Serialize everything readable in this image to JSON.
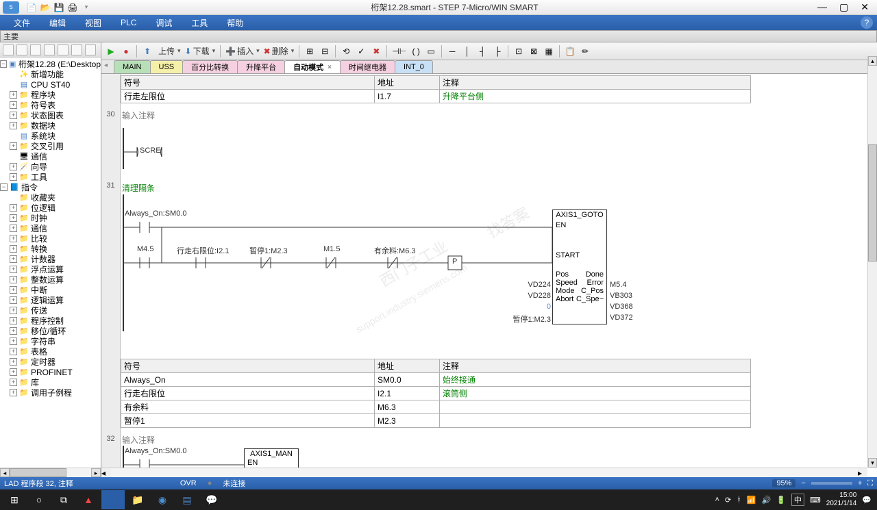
{
  "title": "桁架12.28.smart - STEP 7-Micro/WIN SMART",
  "menu": {
    "file": "文件",
    "edit": "编辑",
    "view": "视图",
    "plc": "PLC",
    "debug": "调试",
    "tools": "工具",
    "help": "帮助"
  },
  "panel_title": "主要",
  "toolbar": {
    "upload": "上传",
    "download": "下载",
    "insert": "插入",
    "delete": "删除"
  },
  "tree": {
    "project": "桁架12.28 (E:\\Desktop",
    "new_feature": "新增功能",
    "cpu": "CPU ST40",
    "program_block": "程序块",
    "symbol_table": "符号表",
    "status_chart": "状态图表",
    "data_block": "数据块",
    "system_block": "系统块",
    "cross_ref": "交叉引用",
    "communication": "通信",
    "wizard": "向导",
    "tool": "工具",
    "instructions": "指令",
    "favorites": "收藏夹",
    "bit_logic": "位逻辑",
    "clock": "时钟",
    "comm2": "通信",
    "compare": "比较",
    "convert": "转换",
    "counter": "计数器",
    "float": "浮点运算",
    "integer": "整数运算",
    "interrupt": "中断",
    "logic_ops": "逻辑运算",
    "transfer": "传送",
    "program_ctrl": "程序控制",
    "shift": "移位/循环",
    "string": "字符串",
    "table": "表格",
    "timer": "定时器",
    "profinet": "PROFINET",
    "library": "库",
    "subroutine": "调用子例程"
  },
  "tabs": {
    "main": "MAIN",
    "uss": "USS",
    "percent": "百分比转换",
    "lift": "升降平台",
    "auto": "自动模式",
    "timer": "时间继电器",
    "int0": "INT_0"
  },
  "sym_hdr": {
    "symbol": "符号",
    "address": "地址",
    "comment": "注释"
  },
  "net29": {
    "sym": "行走左限位",
    "addr": "I1.7",
    "comment": "升降平台侧"
  },
  "net30": {
    "num": "30",
    "placeholder": "输入注释",
    "inst": "SCRE"
  },
  "net31": {
    "num": "31",
    "comment": "清理隔条",
    "always_on": "Always_On:SM0.0",
    "contacts": {
      "m45": "M4.5",
      "limit": "行走右限位:I2.1",
      "pause": "暂停1:M2.3",
      "m15": "M1.5",
      "surplus": "有余料:M6.3",
      "p": "P"
    },
    "fb": {
      "title": "AXIS1_GOTO",
      "en": "EN",
      "start": "START",
      "pos_l": "VD224",
      "pos": "Pos",
      "done": "Done",
      "done_r": "M5.4",
      "speed_l": "VD228",
      "speed": "Speed",
      "error": "Error",
      "error_r": "VB303",
      "mode_l": "0",
      "mode": "Mode",
      "cpos": "C_Pos",
      "cpos_r": "VD368",
      "abort_l": "暂停1:M2.3",
      "abort": "Abort",
      "cspe": "C_Spe~",
      "cspe_r": "VD372"
    },
    "table": [
      {
        "sym": "Always_On",
        "addr": "SM0.0",
        "comment": "始终接通"
      },
      {
        "sym": "行走右限位",
        "addr": "I2.1",
        "comment": "滚筒侧"
      },
      {
        "sym": "有余料",
        "addr": "M6.3",
        "comment": ""
      },
      {
        "sym": "暂停1",
        "addr": "M2.3",
        "comment": ""
      }
    ]
  },
  "net32": {
    "num": "32",
    "placeholder": "输入注释",
    "always_on": "Always_On:SM0.0",
    "fb": {
      "title": "AXIS1_MAN",
      "en": "EN"
    }
  },
  "status": {
    "pos": "LAD 程序段 32, 注释",
    "ovr": "OVR",
    "conn": "未连接",
    "zoom": "95%"
  },
  "taskbar": {
    "ime": "中",
    "time": "15:00",
    "date": "2021/1/14"
  },
  "watermark": {
    "w1": "西门子工业",
    "w2": "找答案",
    "w3": "support.industry.siemens.com"
  }
}
